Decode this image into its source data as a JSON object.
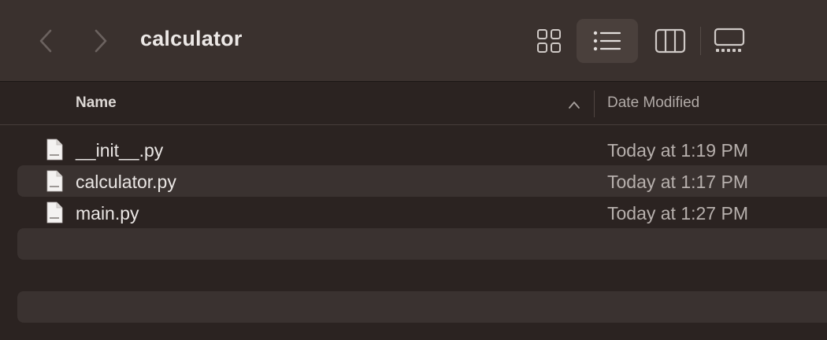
{
  "window": {
    "title": "calculator"
  },
  "toolbar": {
    "back_icon": "chevron-left-icon",
    "forward_icon": "chevron-right-icon",
    "view_modes": [
      {
        "name": "icon-view",
        "icon": "grid-icon",
        "selected": false
      },
      {
        "name": "list-view",
        "icon": "list-icon",
        "selected": true
      },
      {
        "name": "column-view",
        "icon": "columns-icon",
        "selected": false
      },
      {
        "name": "gallery-view",
        "icon": "gallery-icon",
        "selected": false
      }
    ]
  },
  "list": {
    "columns": {
      "name": "Name",
      "date": "Date Modified"
    },
    "sort": {
      "column": "name",
      "direction": "ascending"
    },
    "files": [
      {
        "name": "__init__.py",
        "date": "Today at 1:19 PM",
        "icon": "python-file-icon"
      },
      {
        "name": "calculator.py",
        "date": "Today at 1:17 PM",
        "icon": "python-file-icon"
      },
      {
        "name": "main.py",
        "date": "Today at 1:27 PM",
        "icon": "python-file-icon"
      }
    ]
  },
  "colors": {
    "toolbar_bg": "#3a312e",
    "window_bg": "#2b2321",
    "alt_row_bg": "#3a3230",
    "selected_view_bg": "#4a403c"
  }
}
